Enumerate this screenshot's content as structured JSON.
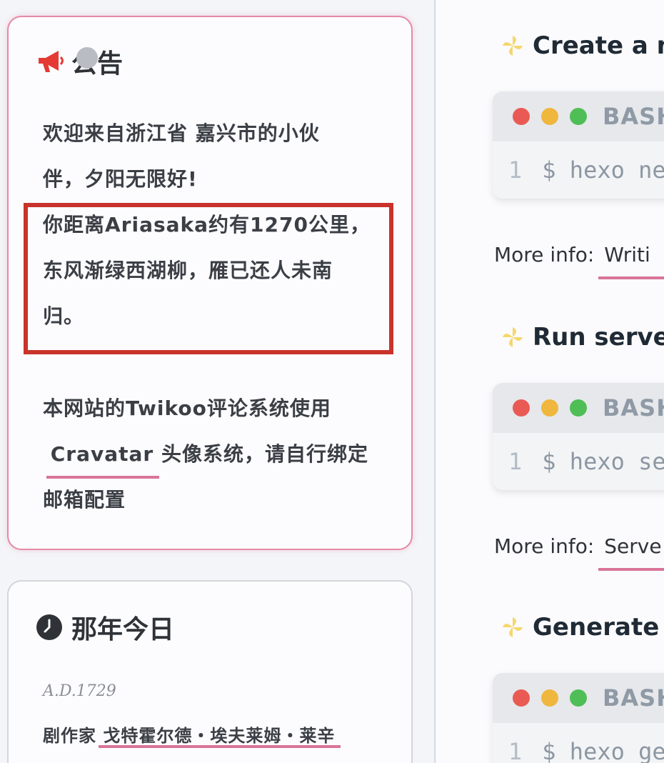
{
  "announcement": {
    "title": "公告",
    "line1": "欢迎来自浙江省 嘉兴市的小伙",
    "line2": "伴，夕阳无限好!",
    "line3": "你距离Ariasaka约有1270公里，",
    "line4": "东风渐绿西湖柳，雁已还人未南",
    "line5": "归。",
    "line6": "本网站的Twikoo评论系统使用",
    "link_cravatar": "Cravatar",
    "line7_rest": " 头像系统，请自行绑定",
    "line8": "邮箱配置"
  },
  "history_today": {
    "title": "那年今日",
    "year": "A.D.1729",
    "text_prefix": "剧作家 ",
    "text_link": "戈特霍尔德・埃夫莱姆・莱辛"
  },
  "sections": [
    {
      "heading": "Create a ne",
      "lang": "BASH",
      "line_no": "1",
      "code": "$ hexo ne",
      "more_label": "More info:",
      "more_link": "Writi"
    },
    {
      "heading": "Run server",
      "lang": "BASH",
      "line_no": "1",
      "code": "$ hexo se",
      "more_label": "More info:",
      "more_link": "Serve"
    },
    {
      "heading": "Generate st",
      "lang": "BASH",
      "line_no": "1",
      "code": "$ hexo ge"
    }
  ],
  "colors": {
    "accent_pink": "#d97499",
    "highlight_red": "#c9332b",
    "window_red": "#ea5a55",
    "window_yellow": "#f0b73e",
    "window_green": "#4fbe56"
  },
  "icons": [
    "megaphone-icon",
    "clock-icon",
    "pinwheel-icon"
  ]
}
